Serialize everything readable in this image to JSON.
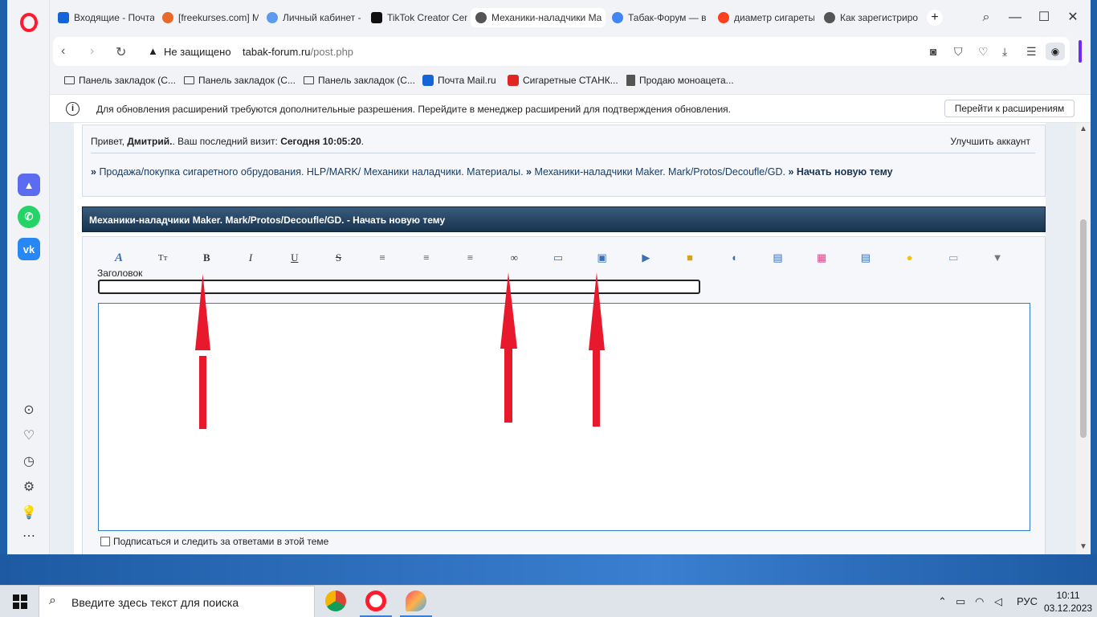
{
  "tabs": [
    {
      "label": "Входящие - Почта",
      "icon": "mail-icon",
      "color": "#1565d8"
    },
    {
      "label": "[freekurses.com] M",
      "icon": "site-icon",
      "color": "#e86a2a"
    },
    {
      "label": "Личный кабинет -",
      "icon": "dots-icon",
      "color": "#5a9bf0"
    },
    {
      "label": "TikTok Creator Cent",
      "icon": "tiktok-icon",
      "color": "#111111"
    },
    {
      "label": "Механики-наладчики Ma",
      "icon": "globe-icon",
      "color": "#555555"
    },
    {
      "label": "Табак-Форум — в",
      "icon": "chrome-icon",
      "color": "#4285f4"
    },
    {
      "label": "диаметр сигареты",
      "icon": "yandex-icon",
      "color": "#fc3f1d"
    },
    {
      "label": "Как зарегистриро",
      "icon": "globe-icon",
      "color": "#555555"
    }
  ],
  "address": {
    "security": "Не защищено",
    "host": "tabak-forum.ru",
    "path": "/post.php"
  },
  "bookmarks": [
    {
      "label": "Панель закладок (С...",
      "icon": "folder-icon"
    },
    {
      "label": "Панель закладок (С...",
      "icon": "folder-icon"
    },
    {
      "label": "Панель закладок (С...",
      "icon": "folder-icon"
    },
    {
      "label": "Почта Mail.ru",
      "icon": "mail-icon"
    },
    {
      "label": "Сигаретные СТАНК...",
      "icon": "phone-icon"
    },
    {
      "label": "Продаю моноацета...",
      "icon": "doc-icon"
    }
  ],
  "infobar": {
    "text": "Для обновления расширений требуются дополнительные разрешения. Перейдите в менеджер расширений для подтверждения обновления.",
    "button": "Перейти к расширениям"
  },
  "forum": {
    "greeting_prefix": "Привет,",
    "username": "Дмитрий.",
    "last_visit_label": ". Ваш последний визит:",
    "last_visit_value": "Сегодня 10:05:20",
    "upgrade": "Улучшить аккаунт",
    "crumb_sep": "»",
    "crumb_1": "Продажа/покупка сигаретного обрудования. HLP/MARK/ Механики наладчики. Материалы.",
    "crumb_2": "Механики-наладчики Maker. Mark/Protos/Decoufle/GD.",
    "crumb_3": "Начать новую тему",
    "section_title": "Механики-наладчики Maker. Mark/Protos/Decoufle/GD. - Начать новую тему",
    "subject_label": "Заголовок",
    "subject_value": "",
    "message_value": "",
    "subscribe_label": "Подписаться и следить за ответами в этой теме"
  },
  "toolbar_buttons": [
    {
      "name": "font-icon",
      "glyph": "A",
      "color": "#3b6fb6"
    },
    {
      "name": "font-size-icon",
      "glyph": "Тт",
      "color": "#333333"
    },
    {
      "name": "bold-icon",
      "glyph": "B",
      "color": "#333333"
    },
    {
      "name": "italic-icon",
      "glyph": "I",
      "color": "#333333"
    },
    {
      "name": "underline-icon",
      "glyph": "U",
      "color": "#333333"
    },
    {
      "name": "strike-icon",
      "glyph": "S",
      "color": "#333333"
    },
    {
      "name": "align-left-icon",
      "glyph": "≡",
      "color": "#333333"
    },
    {
      "name": "align-center-icon",
      "glyph": "≡",
      "color": "#333333"
    },
    {
      "name": "align-right-icon",
      "glyph": "≡",
      "color": "#333333"
    },
    {
      "name": "link-icon",
      "glyph": "∞",
      "color": "#333333"
    },
    {
      "name": "book-icon",
      "glyph": "▭",
      "color": "#3b6fb6"
    },
    {
      "name": "image-icon",
      "glyph": "▣",
      "color": "#3b6fb6"
    },
    {
      "name": "video-icon",
      "glyph": "▶",
      "color": "#3b6fb6"
    },
    {
      "name": "lock-icon",
      "glyph": "■",
      "color": "#d9a21b"
    },
    {
      "name": "quote-icon",
      "glyph": "◖",
      "color": "#3b6fb6"
    },
    {
      "name": "code-icon",
      "glyph": "▤",
      "color": "#3b6fb6"
    },
    {
      "name": "color-grid-icon",
      "glyph": "▦",
      "color": "#d44b8c"
    },
    {
      "name": "table-icon",
      "glyph": "▤",
      "color": "#3b6fb6"
    },
    {
      "name": "smiley-icon",
      "glyph": "●",
      "color": "#f0c419"
    },
    {
      "name": "keyboard-icon",
      "glyph": "▭",
      "color": "#7d9cc4"
    },
    {
      "name": "more-icon",
      "glyph": "▼",
      "color": "#777777"
    }
  ],
  "annotations": {
    "arrow_color": "#e8192c"
  },
  "taskbar": {
    "search_placeholder": "Введите здесь текст для поиска",
    "lang": "РУС",
    "time": "10:11",
    "date": "03.12.2023"
  }
}
